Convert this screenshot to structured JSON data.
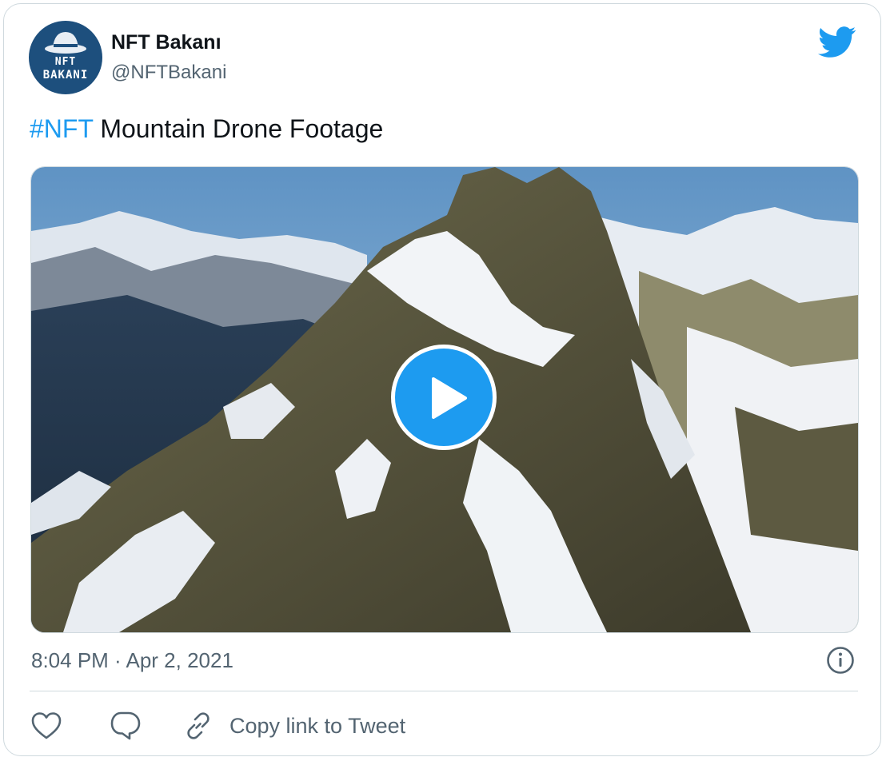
{
  "author": {
    "avatar_text": [
      "NFT",
      "BAKANI"
    ],
    "display_name": "NFT Bakanı",
    "handle": "@NFTBakani"
  },
  "tweet": {
    "hashtag": "#NFT",
    "text": " Mountain Drone Footage"
  },
  "media": {
    "type": "video",
    "play_icon": "play-icon"
  },
  "meta": {
    "timestamp": "8:04 PM · Apr 2, 2021"
  },
  "actions": {
    "copy_link_label": "Copy link to Tweet"
  },
  "colors": {
    "accent": "#1d9bf0",
    "text": "#0f1419",
    "secondary": "#536471",
    "border": "#cfd9de"
  },
  "icons": [
    "twitter-bird-icon",
    "info-icon",
    "heart-icon",
    "reply-icon",
    "link-icon",
    "play-icon"
  ]
}
